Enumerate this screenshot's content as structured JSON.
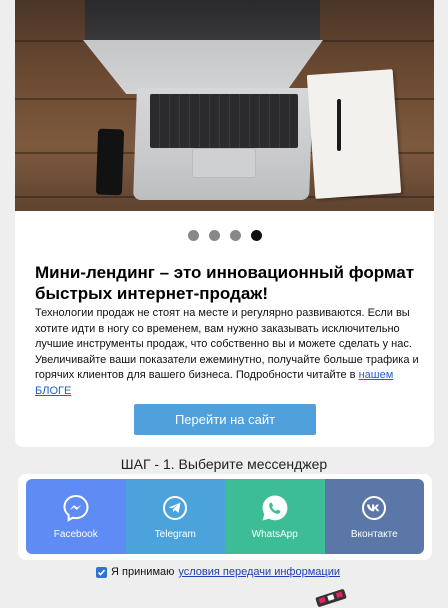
{
  "carousel": {
    "image_icon": "laptop-desk-photo",
    "dots": 4,
    "active_index": 3
  },
  "promo": {
    "title": "Мини-лендинг – это инновационный формат быстрых интернет-продаж!",
    "description": "Технологии продаж не стоят на месте и регулярно развиваются. Если вы хотите идти в ногу со временем, вам нужно заказывать исключительно лучшие инструменты продаж, что собственно вы и можете сделать у нас. Увеличивайте ваши показатели ежеминутно, получайте больше трафика и горячих клиентов для вашего бизнеса. Подробности читайте в",
    "blog_link": "нашем БЛОГЕ",
    "cta_label": "Перейти на сайт"
  },
  "step": {
    "label": "ШАГ - 1. Выберите мессенджер"
  },
  "messengers": [
    {
      "label": "Facebook",
      "icon": "messenger-icon",
      "color": "#5f8bf5"
    },
    {
      "label": "Telegram",
      "icon": "telegram-icon",
      "color": "#4ca3dc"
    },
    {
      "label": "WhatsApp",
      "icon": "whatsapp-icon",
      "color": "#3cbd96"
    },
    {
      "label": "Вконтакте",
      "icon": "vk-icon",
      "color": "#5a77a8"
    }
  ],
  "consent": {
    "checked": true,
    "text": "Я принимаю",
    "link": "условия передачи информации"
  },
  "colors": {
    "accent": "#4fa0db",
    "link": "#1f5fc6",
    "background": "#eeeeee"
  }
}
